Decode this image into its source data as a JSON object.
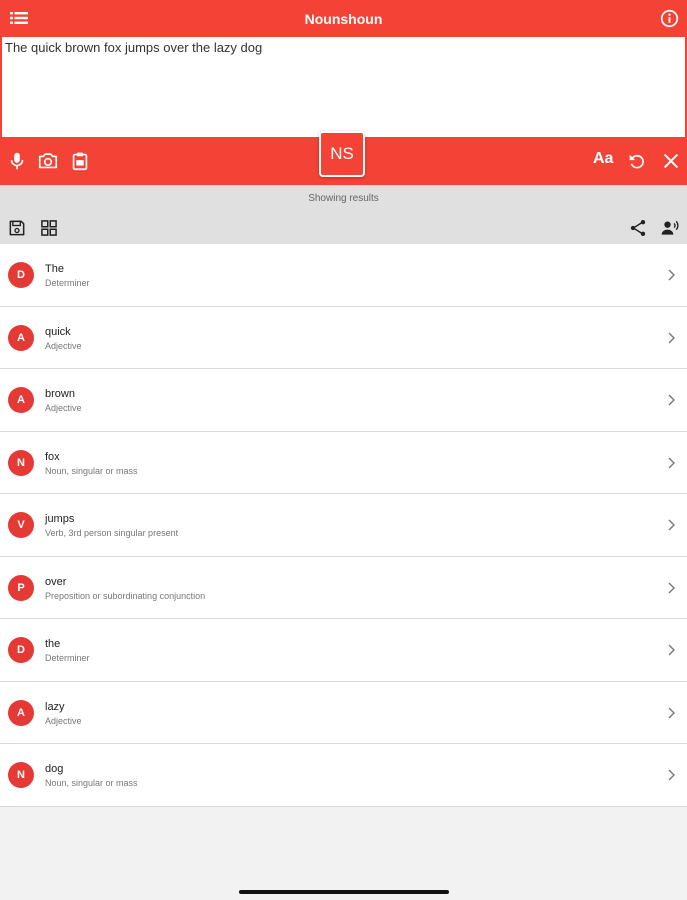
{
  "app": {
    "title": "Nounshoun",
    "accent": "#f44336"
  },
  "input": {
    "text": "The quick brown fox jumps over the lazy dog"
  },
  "toolbar": {
    "logo": "NS",
    "font_label": "Aa"
  },
  "icons": {
    "menu": "menu-icon",
    "info": "info-icon",
    "mic": "mic-icon",
    "camera": "camera-icon",
    "clipboard": "clipboard-icon",
    "reset": "reset-icon",
    "close": "close-icon",
    "save": "save-icon",
    "grid": "grid-icon",
    "share": "share-icon",
    "speak": "speak-icon"
  },
  "status": {
    "text": "Showing results"
  },
  "results": [
    {
      "initial": "D",
      "word": "The",
      "pos": "Determiner"
    },
    {
      "initial": "A",
      "word": "quick",
      "pos": "Adjective"
    },
    {
      "initial": "A",
      "word": "brown",
      "pos": "Adjective"
    },
    {
      "initial": "N",
      "word": "fox",
      "pos": "Noun, singular or mass"
    },
    {
      "initial": "V",
      "word": "jumps",
      "pos": "Verb, 3rd person singular present"
    },
    {
      "initial": "P",
      "word": "over",
      "pos": "Preposition or subordinating conjunction"
    },
    {
      "initial": "D",
      "word": "the",
      "pos": "Determiner"
    },
    {
      "initial": "A",
      "word": "lazy",
      "pos": "Adjective"
    },
    {
      "initial": "N",
      "word": "dog",
      "pos": "Noun, singular or mass"
    }
  ]
}
